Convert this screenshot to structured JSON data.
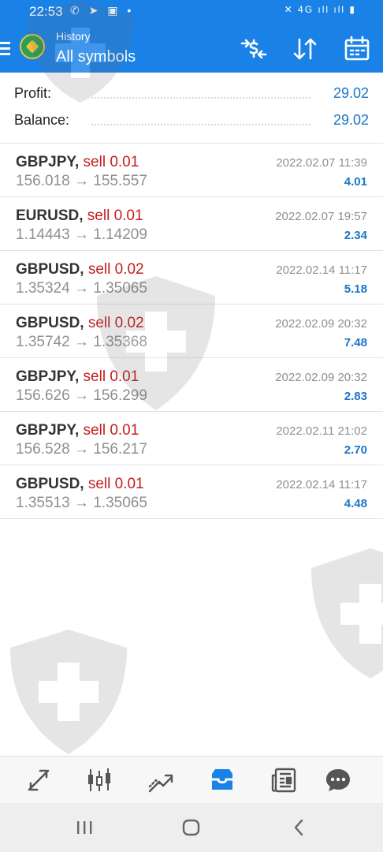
{
  "status_bar": {
    "time": "22:53",
    "left_icons": "✆ ➤ ▣ •",
    "right_icons": "✕ 4G ıll ıll ▮"
  },
  "header": {
    "subtitle": "History",
    "title": "All symbols",
    "icons": [
      "currency-exchange-icon",
      "sort-icon",
      "calendar-icon"
    ],
    "background": "#1a82e6"
  },
  "summary": {
    "profit_label": "Profit:",
    "profit_value": "29.02",
    "balance_label": "Balance:",
    "balance_value": "29.02"
  },
  "arrow": "→",
  "trades": [
    {
      "symbol": "GBPJPY,",
      "side": "sell 0.01",
      "open": "156.018",
      "close": "155.557",
      "datetime": "2022.02.07 11:39",
      "profit": "4.01"
    },
    {
      "symbol": "EURUSD,",
      "side": "sell 0.01",
      "open": "1.14443",
      "close": "1.14209",
      "datetime": "2022.02.07 19:57",
      "profit": "2.34"
    },
    {
      "symbol": "GBPUSD,",
      "side": "sell 0.02",
      "open": "1.35324",
      "close": "1.35065",
      "datetime": "2022.02.14 11:17",
      "profit": "5.18"
    },
    {
      "symbol": "GBPUSD,",
      "side": "sell 0.02",
      "open": "1.35742",
      "close": "1.35368",
      "datetime": "2022.02.09 20:32",
      "profit": "7.48"
    },
    {
      "symbol": "GBPJPY,",
      "side": "sell 0.01",
      "open": "156.626",
      "close": "156.299",
      "datetime": "2022.02.09 20:32",
      "profit": "2.83"
    },
    {
      "symbol": "GBPJPY,",
      "side": "sell 0.01",
      "open": "156.528",
      "close": "156.217",
      "datetime": "2022.02.11 21:02",
      "profit": "2.70"
    },
    {
      "symbol": "GBPUSD,",
      "side": "sell 0.01",
      "open": "1.35513",
      "close": "1.35065",
      "datetime": "2022.02.14 11:17",
      "profit": "4.48"
    }
  ],
  "bottom_nav": {
    "items": [
      "quotes-icon",
      "chart-candles-icon",
      "trade-icon",
      "history-inbox-icon",
      "news-icon",
      "chat-icon"
    ],
    "active": "history-inbox-icon"
  },
  "colors": {
    "accent": "#1a82e6",
    "sell": "#c51e1e",
    "profit": "#1a76c9",
    "muted": "#8f8f8f"
  }
}
